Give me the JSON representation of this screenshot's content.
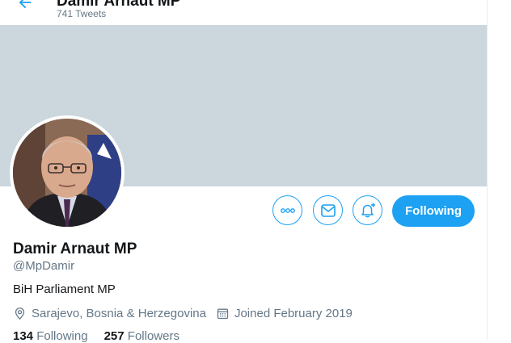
{
  "header": {
    "title": "Damir Arnaut MP",
    "tweet_count": "741 Tweets"
  },
  "profile": {
    "name": "Damir Arnaut MP",
    "handle": "@MpDamir",
    "bio": "BiH Parliament MP",
    "location": "Sarajevo, Bosnia & Herzegovina",
    "joined": "Joined February 2019"
  },
  "actions": {
    "more_icon": "more-icon",
    "message_icon": "envelope-icon",
    "notify_icon": "bell-plus-icon",
    "following_label": "Following"
  },
  "stats": {
    "following_count": "134",
    "following_label": "Following",
    "followers_count": "257",
    "followers_label": "Followers"
  },
  "colors": {
    "accent": "#1da1f2",
    "banner": "#ccd6dd",
    "secondary_text": "#657786"
  }
}
